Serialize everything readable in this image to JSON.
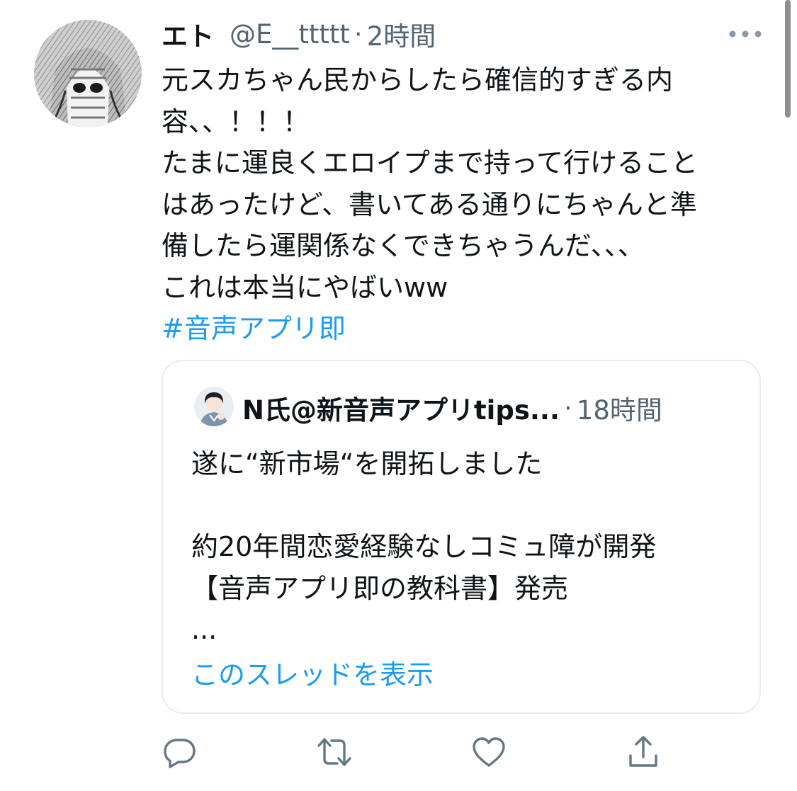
{
  "tweet": {
    "display_name": "エト",
    "handle": "@E__ttttt",
    "separator": "·",
    "time": "2時間",
    "lines": [
      "元スカちゃん民からしたら確信的すぎる内",
      "容、、！！！",
      "たまに運良くエロイプまで持って行けること",
      "はあったけど、書いてある通りにちゃんと準",
      "備したら運関係なくできちゃうんだ、、、",
      "これは本当にやばいww"
    ],
    "hashtag": "#音声アプリ即",
    "more_icon": "more-horizontal-icon",
    "avatar_icon": "masked-figure-avatar"
  },
  "quote": {
    "display_name": "N氏@新音声アプリtips...",
    "separator": "·",
    "time": "18時間",
    "lines": [
      "遂に“新市場“を開拓しました",
      "",
      "約20年間恋愛経験なしコミュ障が開発",
      "【音声アプリ即の教科書】発売",
      "..."
    ],
    "show_thread": "このスレッドを表示",
    "avatar_icon": "illustrated-boy-avatar"
  },
  "actions": {
    "reply_icon": "reply-icon",
    "retweet_icon": "retweet-icon",
    "like_icon": "like-heart-icon",
    "share_icon": "share-icon"
  },
  "colors": {
    "text": "#0f1419",
    "secondary": "#536471",
    "link": "#1d9bf0",
    "border": "#e6ecf0"
  }
}
